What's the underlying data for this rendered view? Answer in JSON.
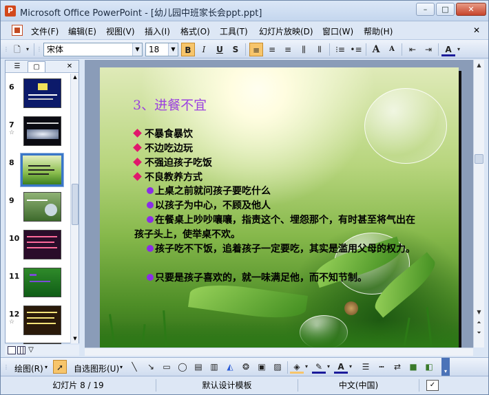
{
  "window": {
    "app_icon": "powerpoint-icon",
    "title": "Microsoft Office PowerPoint - [幼儿园中班家长会ppt.ppt]",
    "controls": {
      "minimize": "–",
      "maximize": "□",
      "close": "✕"
    }
  },
  "menubar": {
    "doc_icon": "document-icon",
    "items": [
      "文件(F)",
      "编辑(E)",
      "视图(V)",
      "插入(I)",
      "格式(O)",
      "工具(T)",
      "幻灯片放映(D)",
      "窗口(W)",
      "帮助(H)"
    ],
    "close_glyph": "✕"
  },
  "formatting_toolbar": {
    "font_name": "宋体",
    "font_size": "18",
    "bold": "B",
    "italic": "I",
    "underline": "U",
    "shadow": "S",
    "grow_font": "A",
    "shrink_font": "A",
    "font_color": "A",
    "accent_color": "#f7c56b"
  },
  "left_pane": {
    "tabs": [
      "outline-tab",
      "slides-tab"
    ],
    "close_glyph": "✕",
    "thumbnails": [
      {
        "num": "6",
        "star": ""
      },
      {
        "num": "7",
        "star": "☆"
      },
      {
        "num": "8",
        "star": ""
      },
      {
        "num": "9",
        "star": ""
      },
      {
        "num": "10",
        "star": ""
      },
      {
        "num": "11",
        "star": ""
      },
      {
        "num": "12",
        "star": "☆"
      }
    ],
    "selected": "8"
  },
  "slide": {
    "title": "3、进餐不宜",
    "bullets": [
      "不暴食暴饮",
      "不边吃边玩",
      "不强迫孩子吃饭",
      "不良教养方式"
    ],
    "sub_bullets": [
      "上桌之前就问孩子要吃什么",
      "以孩子为中心，不顾及他人",
      "在餐桌上吵吵嚷嚷，指责这个、埋怨那个，有时甚至将气出在孩子头上，使举桌不欢。",
      "孩子吃不下饭，追着孩子一定要吃，其实是滥用父母的权力。",
      "只要是孩子喜欢的，就一味满足他，而不知节制。"
    ],
    "colors": {
      "title": "#9b3fe0",
      "diamond": "#e0186c",
      "dot": "#8a2ee6"
    }
  },
  "drawing_toolbar": {
    "draw_menu": "绘图(R)",
    "autoshapes_menu": "自选图形(U)"
  },
  "statusbar": {
    "slide_info": "幻灯片 8 / 19",
    "design": "默认设计模板",
    "language": "中文(中国)"
  }
}
